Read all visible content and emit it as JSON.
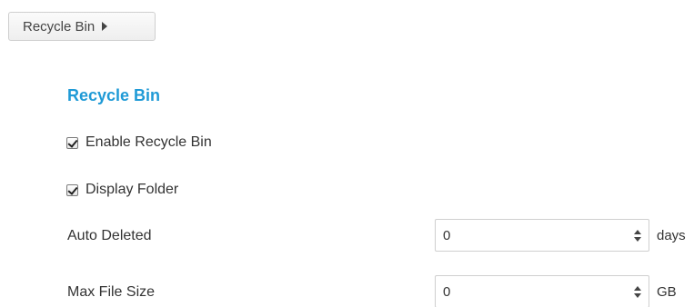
{
  "breadcrumb": {
    "label": "Recycle Bin",
    "icon": "caret-right-icon"
  },
  "section": {
    "title": "Recycle Bin"
  },
  "options": [
    {
      "label": "Enable Recycle Bin",
      "checked": true
    },
    {
      "label": "Display Folder",
      "checked": true
    }
  ],
  "fields": {
    "auto_deleted": {
      "label": "Auto Deleted",
      "value": "0",
      "unit": "days"
    },
    "max_file_size": {
      "label": "Max File Size",
      "value": "0",
      "unit": "GB"
    }
  },
  "colors": {
    "accent": "#1f9ad6"
  }
}
